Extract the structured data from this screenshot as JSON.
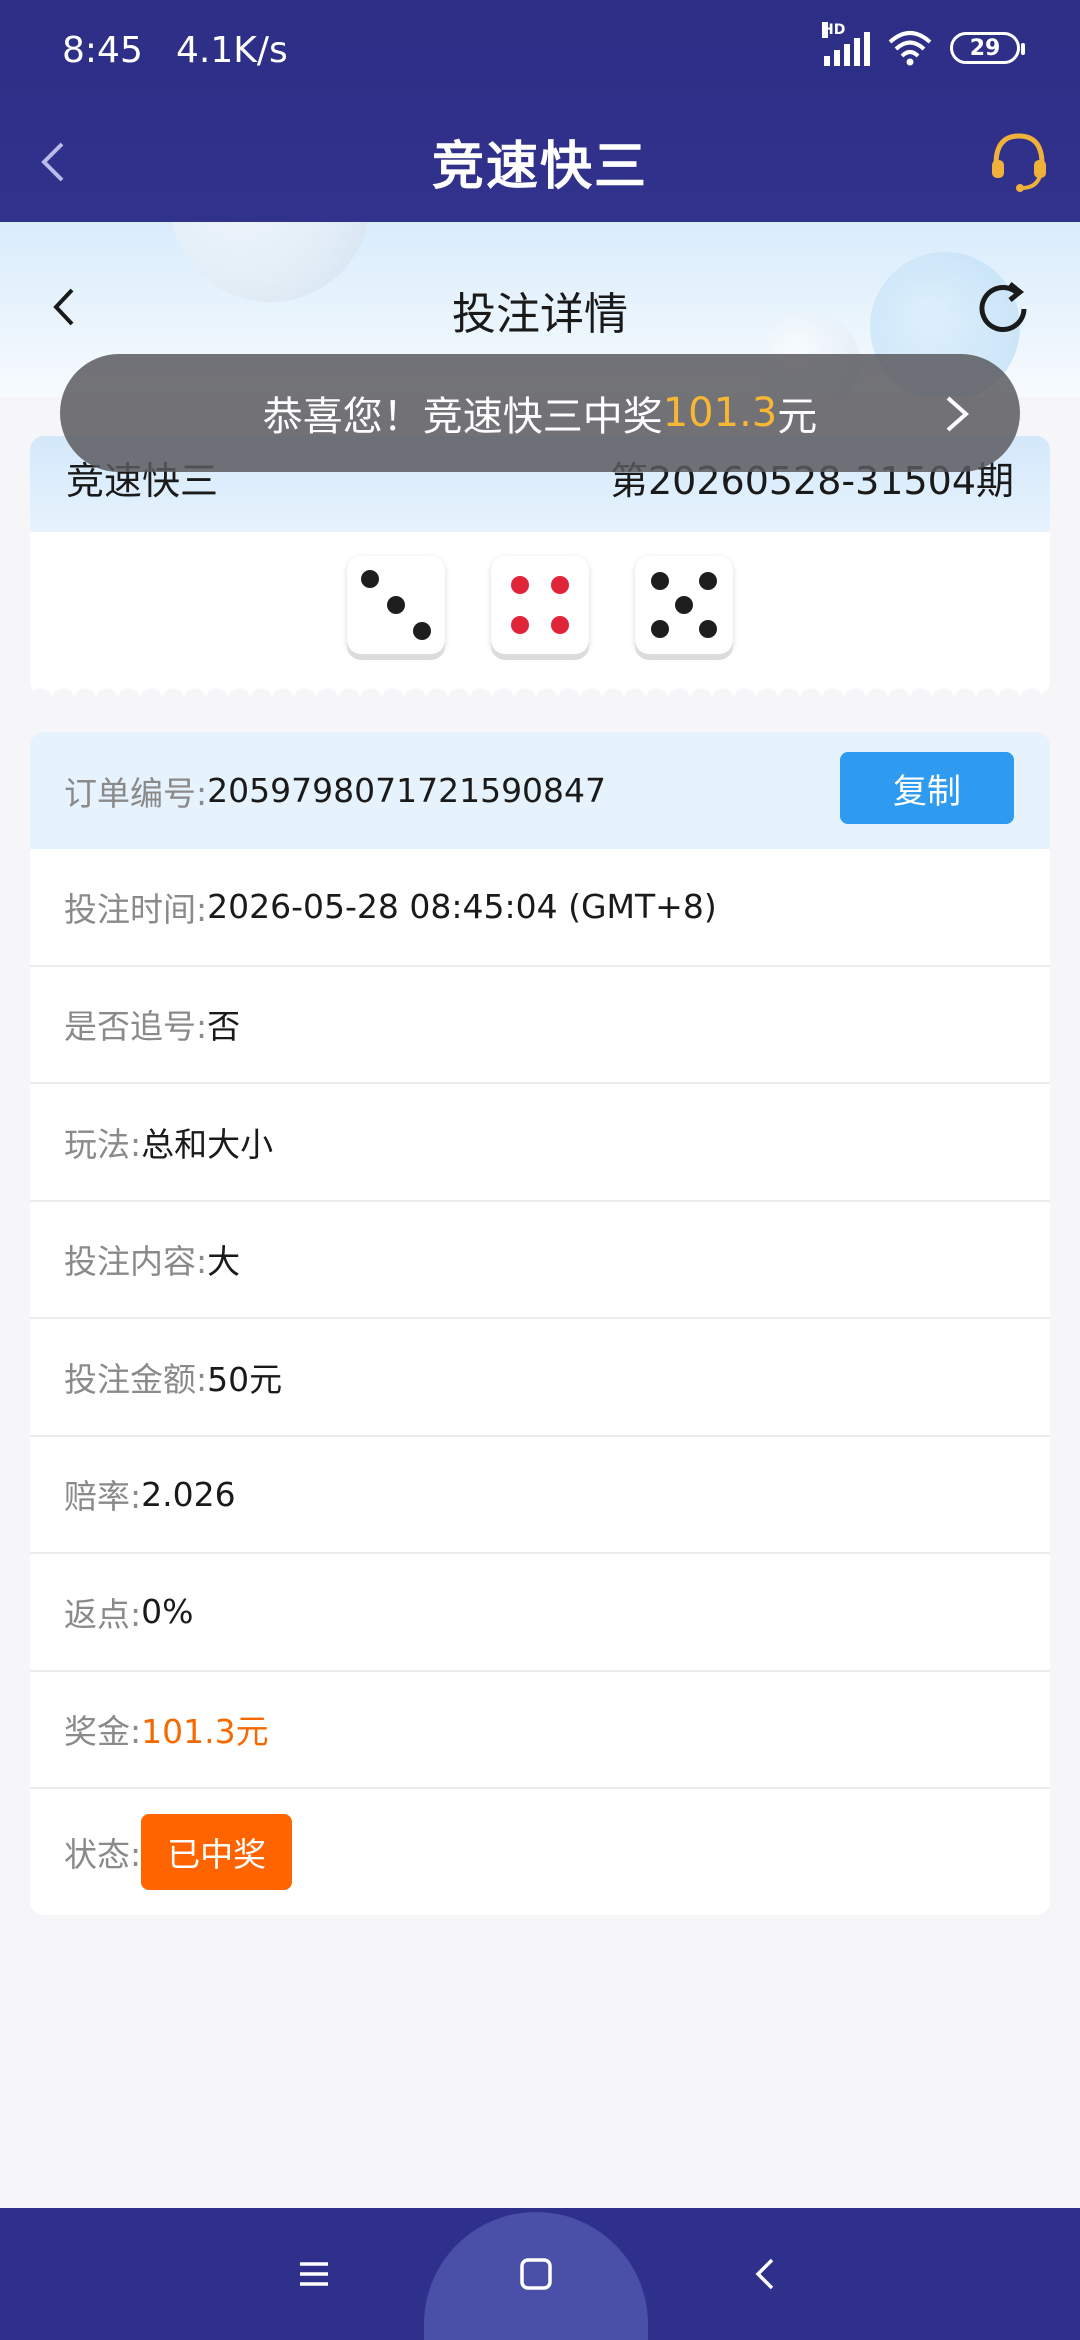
{
  "status_bar": {
    "time": "8:45",
    "speed": "4.1K/s",
    "network_label": "HD",
    "battery": "29"
  },
  "app_nav": {
    "title": "竞速快三"
  },
  "sub_header": {
    "title": "投注详情"
  },
  "toast": {
    "prefix": "恭喜您！竞速快三中奖",
    "amount": "101.3",
    "suffix": "元"
  },
  "result": {
    "game_name": "竞速快三",
    "issue": "第20260528-31504期",
    "dice": [
      3,
      4,
      5
    ]
  },
  "details": {
    "order_label": "订单编号:",
    "order_value": "2059798071721590847",
    "copy_label": "复制",
    "time_label": "投注时间:",
    "time_value": "2026-05-28 08:45:04 (GMT+8)",
    "chase_label": "是否追号:",
    "chase_value": "否",
    "play_label": "玩法:",
    "play_value": "总和大小",
    "content_label": "投注内容:",
    "content_value": "大",
    "amount_label": "投注金额:",
    "amount_value": "50元",
    "odds_label": "赔率:",
    "odds_value": "2.026",
    "rebate_label": "返点:",
    "rebate_value": "0%",
    "prize_label": "奖金:",
    "prize_value": "101.3元",
    "state_label": "状态:",
    "state_value": "已中奖"
  },
  "colors": {
    "header_bg": "#2d2e86",
    "accent_blue": "#2e9bf0",
    "prize_orange": "#f56a00",
    "badge_orange": "#ff6400",
    "toast_amount": "#f7b733"
  },
  "icons": {
    "back": "chevron-left-icon",
    "customer_service": "headset-icon",
    "refresh": "refresh-icon",
    "menu": "menu-icon",
    "home": "home-icon"
  }
}
